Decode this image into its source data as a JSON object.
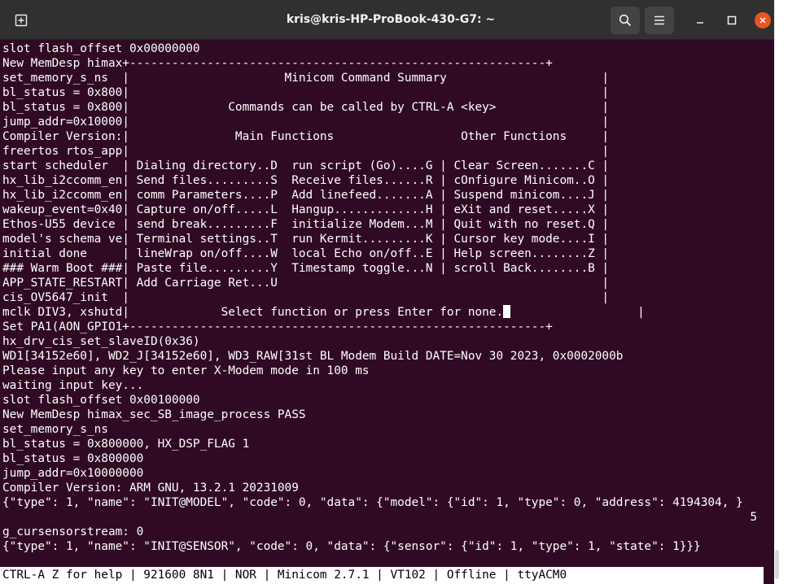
{
  "window": {
    "title": "kris@kris-HP-ProBook-430-G7: ~",
    "colors": {
      "terminal_bg": "#300a24",
      "titlebar_bg": "#303030",
      "close_accent": "#e95420",
      "text": "#ffffff"
    }
  },
  "icons": {
    "new_tab": "new-tab-icon",
    "search": "search-icon",
    "menu": "hamburger-menu-icon",
    "minimize": "minimize-icon",
    "maximize": "maximize-icon",
    "close": "close-icon"
  },
  "terminal": {
    "lines": [
      "slot flash_offset 0x00000000",
      "New MemDesp himax+-----------------------------------------------------------+",
      "set_memory_s_ns  |                      Minicom Command Summary                      |",
      "bl_status = 0x800|                                                                   |",
      "bl_status = 0x800|              Commands can be called by CTRL-A <key>               |",
      "jump_addr=0x10000|                                                                   |",
      "Compiler Version:|               Main Functions                  Other Functions     |",
      "freertos rtos_app|                                                                   |",
      "start scheduler  | Dialing directory..D  run script (Go)....G | Clear Screen.......C |",
      "hx_lib_i2ccomm_en| Send files.........S  Receive files......R | cOnfigure Minicom..O |",
      "hx_lib_i2ccomm_en| comm Parameters....P  Add linefeed.......A | Suspend minicom....J |",
      "wakeup_event=0x40| Capture on/off.....L  Hangup.............H | eXit and reset.....X |",
      "Ethos-U55 device | send break.........F  initialize Modem...M | Quit with no reset.Q |",
      "model's schema ve| Terminal settings..T  run Kermit.........K | Cursor key mode....I |",
      "initial done     | lineWrap on/off....W  local Echo on/off..E | Help screen........Z |",
      "### Warm Boot ###| Paste file.........Y  Timestamp toggle...N | scroll Back........B |",
      "APP_STATE_RESTART| Add Carriage Ret...U                                              |",
      "cis_OV5647_init  |                                                                   |",
      "mclk DIV3, xshutd|             Select function or press Enter for none.",
      "Set PA1(AON_GPIO1+-----------------------------------------------------------+",
      "hx_drv_cis_set_slaveID(0x36)",
      "WD1[34152e60], WD2_J[34152e60], WD3_RAW[31st BL Modem Build DATE=Nov 30 2023, 0x0002000b",
      "Please input any key to enter X-Modem mode in 100 ms",
      "waiting input key...",
      "slot flash_offset 0x00100000",
      "New MemDesp himax_sec_SB_image_process PASS",
      "set_memory_s_ns",
      "bl_status = 0x800000, HX_DSP_FLAG 1",
      "bl_status = 0x800000",
      "jump_addr=0x10000000",
      "Compiler Version: ARM GNU, 13.2.1 20231009",
      "{\"type\": 1, \"name\": \"INIT@MODEL\", \"code\": 0, \"data\": {\"model\": {\"id\": 1, \"type\": 0, \"address\": 4194304, }",
      "                                                                                                          5",
      "g_cursensorstream: 0",
      "{\"type\": 1, \"name\": \"INIT@SENSOR\", \"code\": 0, \"data\": {\"sensor\": {\"id\": 1, \"type\": 1, \"state\": 1}}}"
    ],
    "select_suffix": "                  |"
  },
  "statusbar": {
    "text": "CTRL-A Z for help | 921600 8N1 | NOR | Minicom 2.7.1 | VT102 | Offline | ttyACM0"
  }
}
